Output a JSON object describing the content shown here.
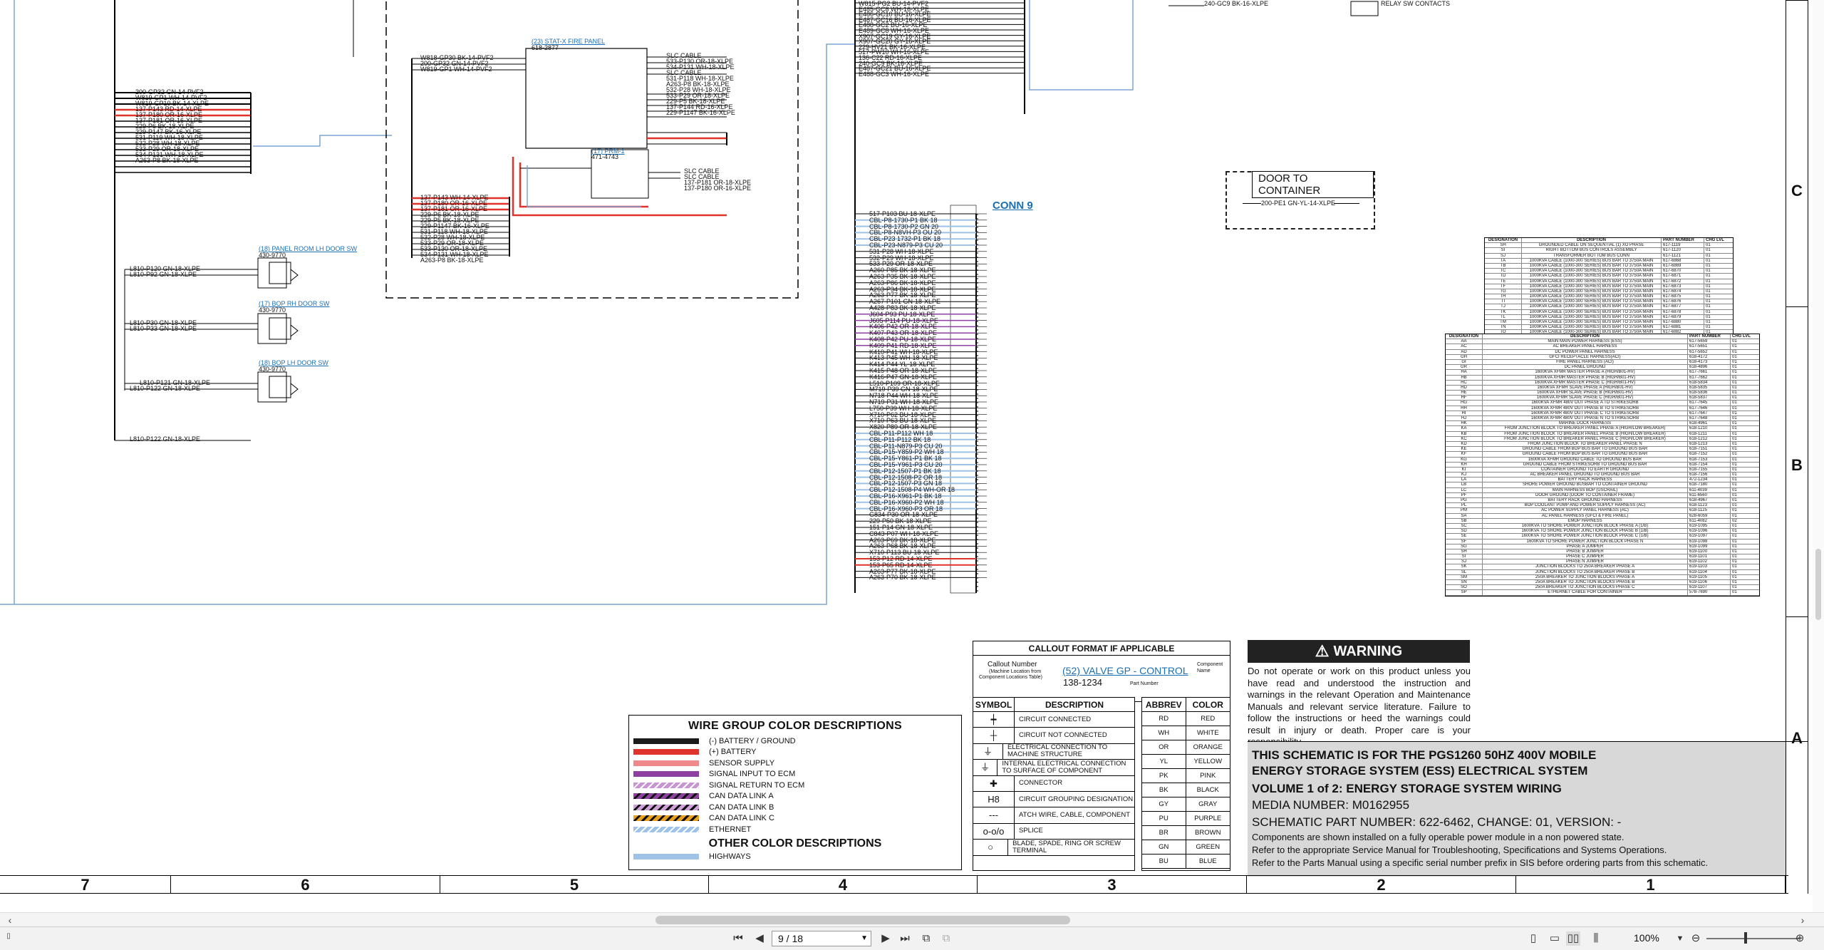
{
  "wire_legend": {
    "title": "WIRE GROUP COLOR DESCRIPTIONS",
    "items": [
      {
        "label": "(-) BATTERY / GROUND",
        "color": "#1a1a1a",
        "pattern": "solid"
      },
      {
        "label": "(+) BATTERY",
        "color": "#e0332b",
        "pattern": "solid"
      },
      {
        "label": "SENSOR SUPPLY",
        "color": "#f08a8a",
        "pattern": "solid"
      },
      {
        "label": "SIGNAL INPUT TO ECM",
        "color": "#8e3fa0",
        "pattern": "solid"
      },
      {
        "label": "SIGNAL RETURN TO ECM",
        "color": "#c895d3",
        "pattern": "hatched"
      },
      {
        "label": "CAN DATA LINK A",
        "color": "#8e3fa0",
        "pattern": "striped-black"
      },
      {
        "label": "CAN DATA LINK B",
        "color": "#d0a0d8",
        "pattern": "striped-black"
      },
      {
        "label": "CAN DATA LINK C",
        "color": "#e8a020",
        "pattern": "striped-black"
      },
      {
        "label": "ETHERNET",
        "color": "#9ec3e6",
        "pattern": "hatched"
      }
    ],
    "other_title": "OTHER COLOR DESCRIPTIONS",
    "other_items": [
      {
        "label": "HIGHWAYS",
        "color": "#9ec3e6",
        "pattern": "solid"
      }
    ]
  },
  "callout": {
    "title": "CALLOUT FORMAT IF APPLICABLE",
    "callout_number": "Callout Number",
    "machine_location": "(Machine Location from",
    "component_locations": "Component Locations Table)",
    "example": "(52) VALVE GP - CONTROL",
    "part_example": "138-1234",
    "part_number_label": "Part Number",
    "component_name_label": "Component Name"
  },
  "symbols": {
    "header_symbol": "SYMBOL",
    "header_description": "DESCRIPTION",
    "rows": [
      {
        "symbol": "┿",
        "description": "CIRCUIT CONNECTED"
      },
      {
        "symbol": "┼",
        "description": "CIRCUIT NOT CONNECTED"
      },
      {
        "symbol": "⏚",
        "description": "ELECTRICAL CONNECTION TO MACHINE STRUCTURE"
      },
      {
        "symbol": "⏚",
        "description": "INTERNAL ELECTRICAL CONNECTION TO SURFACE OF COMPONENT"
      },
      {
        "symbol": "✚",
        "description": "CONNECTOR"
      },
      {
        "symbol": "H8",
        "description": "CIRCUIT GROUPING DESIGNATION"
      },
      {
        "symbol": "---",
        "description": "ATCH WIRE, CABLE, COMPONENT"
      },
      {
        "symbol": "o-o/o",
        "description": "SPLICE"
      },
      {
        "symbol": "○",
        "description": "BLADE, SPADE, RING OR SCREW TERMINAL"
      }
    ]
  },
  "abbrev": {
    "header_abbrev": "ABBREV",
    "header_color": "COLOR",
    "rows": [
      [
        "RD",
        "RED"
      ],
      [
        "WH",
        "WHITE"
      ],
      [
        "OR",
        "ORANGE"
      ],
      [
        "YL",
        "YELLOW"
      ],
      [
        "PK",
        "PINK"
      ],
      [
        "BK",
        "BLACK"
      ],
      [
        "GY",
        "GRAY"
      ],
      [
        "PU",
        "PURPLE"
      ],
      [
        "BR",
        "BROWN"
      ],
      [
        "GN",
        "GREEN"
      ],
      [
        "BU",
        "BLUE"
      ]
    ]
  },
  "warning": {
    "title": "WARNING",
    "text": "Do not operate or work on this product unless you have read and understood the instruction and warnings in the relevant Operation and Maintenance Manuals and relevant service literature. Failure to follow the instructions or heed the warnings could result in injury or death. Proper care is your responsibility."
  },
  "title_block": {
    "line1": "THIS SCHEMATIC IS FOR THE  PGS1260 50HZ 400V MOBILE",
    "line2": "ENERGY STORAGE SYSTEM (ESS) ELECTRICAL SYSTEM",
    "line3": "VOLUME 1 of 2: ENERGY STORAGE SYSTEM WIRING",
    "media": "MEDIA NUMBER: M0162955",
    "schematic": "SCHEMATIC PART NUMBER: 622-6462, CHANGE: 01, VERSION: -",
    "note1": "Components are shown installed on a fully operable power module in a non powered state.",
    "note2": "Refer to the appropriate Service Manual for Troubleshooting, Specifications and Systems Operations.",
    "note3": "Refer to the Parts Manual using a specific serial number prefix in SIS before ordering parts from this schematic."
  },
  "grid": {
    "columns": [
      "7",
      "6",
      "5",
      "4",
      "3",
      "2",
      "1"
    ],
    "rows": [
      "C",
      "B",
      "A"
    ]
  },
  "schematic": {
    "conn9": "CONN 9",
    "door": "DOOR TO CONTAINER",
    "door_wire": "200-PE1 GN-YL-14-XLPE",
    "stat_x": "(23) STAT-X FIRE PANEL",
    "stat_x_part": "618-2877",
    "prm": "(17) PRM-1",
    "prm_part": "471-4743",
    "door_sw1": "(18) PANEL ROOM LH DOOR SW",
    "door_sw1_part": "430-9770",
    "door_sw2": "(17) BOP RH DOOR SW",
    "door_sw2_part": "430-9770",
    "door_sw3": "(18) BOP LH DOOR SW",
    "door_sw3_part": "430-9770",
    "wires_left": [
      "200-GP32 GN-14-PVF2",
      "W819-GP1 WH-14-PVF2",
      "W819-GP10 BK-14-XLPE",
      "137-P143 RD-14-XLPE",
      "137-P180 OR-16-XLPE",
      "137-P181 OR-16-XLPE",
      "229-P6 BK-18-XLPE",
      "229-P147 BK-16-XLPE",
      "531-P119 WH-18-XLPE",
      "532-P28 WH-18-XLPE",
      "533-P29 OR-18-XLPE",
      "534-P131 WH-18-XLPE",
      "A263-P8 BK-18-XLPE"
    ],
    "wires_door": [
      "L810-P120 GN-18-XLPE",
      "L810-P92 GN-18-XLPE",
      "L810-P30 GN-18-XLPE",
      "L810-P33 GN-18-XLPE",
      "L810-P121 GN-18-XLPE",
      "L810-P122 GN-18-XLPE",
      "L810-P122 GN-18-XLPE"
    ],
    "wires_statx_right": [
      "SLC CABLE",
      "533-P130 OR-18-XLPE",
      "534-P131 WH-18-XLPE",
      "SLC CABLE",
      "531-P118 WH-18-XLPE",
      "A263-P8 BK-18-XLPE",
      "532-P28 WH-18-XLPE",
      "533-P29 OR-18-XLPE",
      "229-P5 BK-18-XLPE",
      "137-P144 RD-16-XLPE",
      "229-P1147 BK-16-XLPE"
    ],
    "wires_statx_left": [
      "W818-GP30 BK-14-PVF2",
      "200-GP32 GN-14-PVF2",
      "W819-GP1 WH-14-PVF2"
    ],
    "wires_prm": [
      "SLC CABLE",
      "SLC CABLE",
      "137-P181 OR-18-XLPE",
      "137-P180 OR-16-XLPE"
    ],
    "wires_lower_mid": [
      "137-P143 WH-14-XLPE",
      "137-P180 OR-16-XLPE",
      "137-P181 OR-16-XLPE",
      "229-P6 BK-18-XLPE",
      "229-P5 BK-18-XLPE",
      "229-P1147 BK-16-XLPE",
      "531-P118 WH-18-XLPE",
      "532-P28 WH-18-XLPE",
      "533-P29 OR-18-XLPE",
      "533-P130 OR-18-XLPE",
      "534-P131 WH-18-XLPE",
      "A263-P8 BK-18-XLPE"
    ],
    "wires_conn9_top": [
      "W815-PG2 BU-14-PVF2",
      "E485-GC8 WH-16-XLPE",
      "E486-GC10 BU-16-XLPE",
      "E487-GC16 BU-16-XLPE",
      "E488-GC2 BU-16-XLPE",
      "E489-GC8 WH-16-XLPE",
      "X907-GC19 GY-16-XLPE",
      "X907-GC20 GY-16-XLPE",
      "229-HV21 BK-16-XLPE",
      "517-PW10 WH-16-XLPE",
      "136-C22 RD-16-XLPE",
      "240-GC9 BK-16-XLPE",
      "E487-GC21 BU-16-XLPE",
      "E488-GC3 WH-16-XLPE"
    ],
    "wires_conn9": [
      "517-P103 BU-18-XLPE",
      "CBL-P8-1730-P1 BK 18",
      "CBL-P8-1730-P2 GN 20",
      "CBL-P8-N8VH-P3 OU 20",
      "CBL-P23 1732-P1 BK 18",
      "CBL-P23-N879-P3 CU 20",
      "531-P28 WH-18-XLPE",
      "532-P29 WH-18-XLPE",
      "533-P29 OR-18-XLPE",
      "A260-P85 BK-18-XLPE",
      "A263-P35 BK-18-XLPE",
      "A263-P86 BK-18-XLPE",
      "A263-P34 BK-18-XLPE",
      "A263-P77 BK-18-XLPE",
      "A267-P101 GN-18-XLPE",
      "A428-P83 BK-18-XLPE",
      "J604-P93 PU-18-XLPE",
      "J605-P114 PU-18-XLPE",
      "K406-P42 OR-18-XLPE",
      "K407-P43 OR-18-XLPE",
      "K408-P42 PU-18-XLPE",
      "K409-P41 RD-18-XLPE",
      "K410-P41 WH-18-XLPE",
      "K413-P45 WH-18-XLPE",
      "K414-P44 YL-18-XLPE",
      "K415-P48 OR-18-XLPE",
      "K416-P47 GN-18-XLPE",
      "L510-P109 OR-18-XLPE",
      "M719-P39 GN-18-XLPE",
      "N718-P44 WH-18-XLPE",
      "N719-P31 WH-18-XLPE",
      "L750-P39 WH-18-XLPE",
      "X710-P62 BU-18-XLPE",
      "X710-P63 BU-18-XLPE",
      "X820-P89 OR-18-XLPE",
      "CBL-P11-P112 WH 18",
      "CBL-P11-P112 BK 18",
      "CBL-P11-N879-P3 CU 20",
      "CBL-P15-Y859-P2 WH 18",
      "CBL-P15-Y861-P1 BK 18",
      "CBL-P15-Y961-P3 CU 20",
      "CBL-P12-1507-P1 BK 18",
      "CBL-P12-1508-P2 OR 18",
      "CBL-P12-1507-P3 GN 18",
      "CBL-P12-1508-P4 WH-OR 18",
      "CBL-P16-X961-P1 BK 18",
      "CBL-P16-X960-P2 WH 18",
      "CBL-P16-X960-P3 OR 18",
      "G834-P30 OR-18-XLPE",
      "229-P50 BK-18-XLPE",
      "151-P14 GN-18-XLPE",
      "C843-P07 WH-18-XLPE",
      "A263-P69 BK-18-XLPE",
      "A263-P68 BK-18-XLPE",
      "X710-P113 BU-18-XLPE",
      "153-P12 RD-14-XLPE",
      "153-P65 RD-14-XLPE",
      "A263-P77 BK-18-XLPE",
      "A263-P70 BK-18-XLPE"
    ],
    "relay_note": "240-GC9 BK-16-XLPE",
    "relay_label": "RELAY SW CONTACTS"
  },
  "parts_table_top": {
    "headers": [
      "DESIGNATION",
      "DESCRIPTION",
      "PART NUMBER",
      "CHG LVL"
    ],
    "rows": [
      [
        "SH",
        "GROUNDED CABLE ON SEQUENTIAL (1) XO PHASE",
        "617-1119",
        "01"
      ],
      [
        "SI",
        "RIGHT BOTTOM BUS CONTROLS ASSEMBLY",
        "617-1120",
        "01"
      ],
      [
        "SJ",
        "TRANSFORMER BOTTOM BUS CONN",
        "617-1121",
        "01"
      ],
      [
        "TA",
        "1000KVA CABLE (1000-300 SERIES) BUS BAR TO 3750A MAIN",
        "617-6868",
        "01"
      ],
      [
        "TB",
        "1000KVA CABLE (1000-300 SERIES) BUS BAR TO 3750A MAIN",
        "617-6869",
        "01"
      ],
      [
        "TC",
        "1000KVA CABLE (1000-300 SERIES) BUS BAR TO 3750A MAIN",
        "617-6870",
        "01"
      ],
      [
        "TD",
        "1000KVA CABLE (1000-300 SERIES) BUS BAR TO 3750A MAIN",
        "617-6871",
        "01"
      ],
      [
        "TE",
        "1000KVA CABLE (1000-300 SERIES) BUS BAR TO 3750A MAIN",
        "617-6872",
        "01"
      ],
      [
        "TF",
        "1000KVA CABLE (1000-300 SERIES) BUS BAR TO 3750A MAIN",
        "617-6873",
        "01"
      ],
      [
        "TG",
        "1000KVA CABLE (1000-300 SERIES) BUS BAR TO 3750A MAIN",
        "617-6874",
        "01"
      ],
      [
        "TH",
        "1000KVA CABLE (1000-300 SERIES) BUS BAR TO 3750A MAIN",
        "617-6875",
        "01"
      ],
      [
        "TI",
        "1000KVA CABLE (1000-300 SERIES) BUS BAR TO 3750A MAIN",
        "617-6876",
        "01"
      ],
      [
        "TJ",
        "1000KVA CABLE (1000-300 SERIES) BUS BAR TO 3750A MAIN",
        "617-6877",
        "01"
      ],
      [
        "TK",
        "1000KVA CABLE (1000-300 SERIES) BUS BAR TO 3750A MAIN",
        "617-6878",
        "01"
      ],
      [
        "TL",
        "1000KVA CABLE (1000-300 SERIES) BUS BAR TO 3750A MAIN",
        "617-6879",
        "01"
      ],
      [
        "TM",
        "1000KVA CABLE (1000-300 SERIES) BUS BAR TO 3750A MAIN",
        "617-6880",
        "01"
      ],
      [
        "TN",
        "1000KVA CABLE (1000-300 SERIES) BUS BAR TO 3750A MAIN",
        "617-6881",
        "01"
      ],
      [
        "TO",
        "1000KVA CABLE (1000-300 SERIES) BUS BAR TO 3750A MAIN",
        "617-6882",
        "01"
      ],
      [
        "TP",
        "BUS BAR CONTROL CABLE GROUND",
        "617-6883",
        "01"
      ]
    ]
  },
  "parts_table_main": {
    "headers": [
      "DESIGNATION",
      "DESCRIPTION",
      "PART NUMBER",
      "CHG LVL"
    ],
    "rows": [
      [
        "AA",
        "MAIN MAIN POWER HARNESS (ESS)",
        "617-5659",
        "01"
      ],
      [
        "AC",
        "AC BREAKER PANEL HARNESS",
        "617-5651",
        "01"
      ],
      [
        "AD",
        "DC POWER PANEL HARNESS",
        "617-5652",
        "01"
      ],
      [
        "GH",
        "GFCI RECEPTACLE HARNESS(ACI)",
        "618-4172",
        "01"
      ],
      [
        "GI",
        "FIRE PANEL HARNESS (ACI)",
        "618-4173",
        "01"
      ],
      [
        "GR",
        "DC PANEL GROUND",
        "618-4896",
        "01"
      ],
      [
        "HA",
        "1600KVA XFMR MASTER PHASE A (HIGH/B01-HV)",
        "617-7661",
        "01"
      ],
      [
        "HB",
        "1600KVA XFMR MASTER PHASE B (HIGH/B01-HV)",
        "617-7662",
        "01"
      ],
      [
        "HC",
        "1600KVA XFMR MASTER PHASE C (HIGH/B01-HV)",
        "618-5834",
        "01"
      ],
      [
        "HD",
        "1600KVA XFMR SLAVE PHASE A (HIGH/B01-HV)",
        "618-5835",
        "01"
      ],
      [
        "HE",
        "1600KVA XFMR SLAVE PHASE B (HIGH/B01-HV)",
        "618-5836",
        "01"
      ],
      [
        "HF",
        "1600KVA XFMR SLAVE PHASE C (HIGH/B01-HV)",
        "618-5837",
        "01"
      ],
      [
        "HG",
        "1600KVA XFMR 480V OUT PHASE A TO STRIKESORB",
        "617-7645",
        "01"
      ],
      [
        "HH",
        "1600KVA XFMR 480V OUT PHASE B TO STRIKESORB",
        "617-7646",
        "01"
      ],
      [
        "HI",
        "1600KVA XFMR 480V OUT PHASE C TO STRIKESORB",
        "617-7647",
        "01"
      ],
      [
        "HJ",
        "1600KVA XFMR 480V OUT PHASE N TO STRIKESORB",
        "617-7648",
        "01"
      ],
      [
        "HK",
        "MARINE DOCK HARNESS",
        "618-4961",
        "01"
      ],
      [
        "KA",
        "FROM JUNCTION BLOCK TO BREAKER PANEL PHASE A (HIGH/LOW BREAKER)",
        "618-1210",
        "01"
      ],
      [
        "KB",
        "FROM JUNCTION BLOCK TO BREAKER PANEL PHASE B (HIGH/LOW BREAKER)",
        "618-1211",
        "01"
      ],
      [
        "KC",
        "FROM JUNCTION BLOCK TO BREAKER PANEL PHASE C (HIGH/LOW BREAKER)",
        "618-1212",
        "01"
      ],
      [
        "KD",
        "FROM JUNCTION BLOCK TO BREAKER PANEL PHASE N",
        "618-1213",
        "01"
      ],
      [
        "KE",
        "GROUND CABLE FROM BOP BUS BAR TO GROUND BUS BAR",
        "618-7151",
        "01"
      ],
      [
        "KF",
        "GROUND CABLE FROM BOP BUS BAR TO GROUND BUS BAR",
        "618-7152",
        "01"
      ],
      [
        "KG",
        "1600KVA XFMR GROUND CABLE TO GROUND BUS BAR",
        "618-7153",
        "01"
      ],
      [
        "KH",
        "GROUND CABLE FROM STRIKESORB TO GROUND BUS BAR",
        "618-7154",
        "01"
      ],
      [
        "KI",
        "CONTAINER GROUND TO EARTH GROUND",
        "618-7155",
        "01"
      ],
      [
        "KJ",
        "AC BREAKER PANEL GROUND TO GROUND BUS BAR",
        "618-7156",
        "01"
      ],
      [
        "LA",
        "BATTERY RACK HARNESS",
        "472-1234",
        "01"
      ],
      [
        "LB",
        "SHORE POWER GROUND BUSBAR TO CONTAINER GROUND",
        "618-7180",
        "01"
      ],
      [
        "LC",
        "MAIN HARNESS BOP (USCRAIL)",
        "611-4039",
        "01"
      ],
      [
        "PF",
        "DOOR GROUND (DOOR TO CONTAINER FRAME)",
        "611-6560",
        "01"
      ],
      [
        "PG",
        "BATTERY RACK GROUND HARNESS",
        "618-4967",
        "01"
      ],
      [
        "PL",
        "BOP COOLANT PUMP AND POWER SUPPLY HARNESS (AC)",
        "618-1123",
        "01"
      ],
      [
        "PM",
        "AC POWER SUPPLY PANEL HARNESS (AC)",
        "618-1125",
        "01"
      ],
      [
        "SA",
        "AC PANEL HARNESS (GFCI & FIRE PANEL)",
        "628-6059",
        "01"
      ],
      [
        "SB",
        "EMOP HARNESS",
        "611-4082",
        "02"
      ],
      [
        "SC",
        "1600KVA TO SHORE POWER JUNCTION BLOCK PHASE A (1/B)",
        "619-1095",
        "01"
      ],
      [
        "SD",
        "1600KVA TO SHORE POWER JUNCTION BLOCK PHASE B (1/B)",
        "619-1096",
        "01"
      ],
      [
        "SE",
        "1600KVA TO SHORE POWER JUNCTION BLOCK PHASE C (1/B)",
        "619-1097",
        "01"
      ],
      [
        "SF",
        "1600KVA TO SHORE POWER JUNCTION BLOCK PHASE N",
        "619-1098",
        "01"
      ],
      [
        "SG",
        "PHASE A JUMPER",
        "619-1099",
        "01"
      ],
      [
        "SH",
        "PHASE B JUMPER",
        "619-1100",
        "01"
      ],
      [
        "SI",
        "PHASE C JUMPER",
        "619-1101",
        "01"
      ],
      [
        "SJ",
        "PHASE N JUMPER",
        "619-1102",
        "01"
      ],
      [
        "SK",
        "JUNCTION BLOCKS TO 250A BREAKER PHASE A",
        "619-1103",
        "01"
      ],
      [
        "SL",
        "JUNCTION BLOCKS TO 250A BREAKER PHASE B",
        "619-1104",
        "01"
      ],
      [
        "SM",
        "250A BREAKER TO JUNCTION BLOCKS PHASE A",
        "619-1105",
        "01"
      ],
      [
        "SN",
        "250A BREAKER TO JUNCTION BLOCKS PHASE B",
        "619-1106",
        "01"
      ],
      [
        "SO",
        "250A BREAKER TO JUNCTION BLOCKS PHASE C",
        "619-1107",
        "01"
      ],
      [
        "SP",
        "ETHERNET CABLE FOR CONTAINER",
        "578-7690",
        "01"
      ]
    ]
  },
  "toolbar": {
    "page_value": "9 / 18",
    "zoom": "100%"
  }
}
